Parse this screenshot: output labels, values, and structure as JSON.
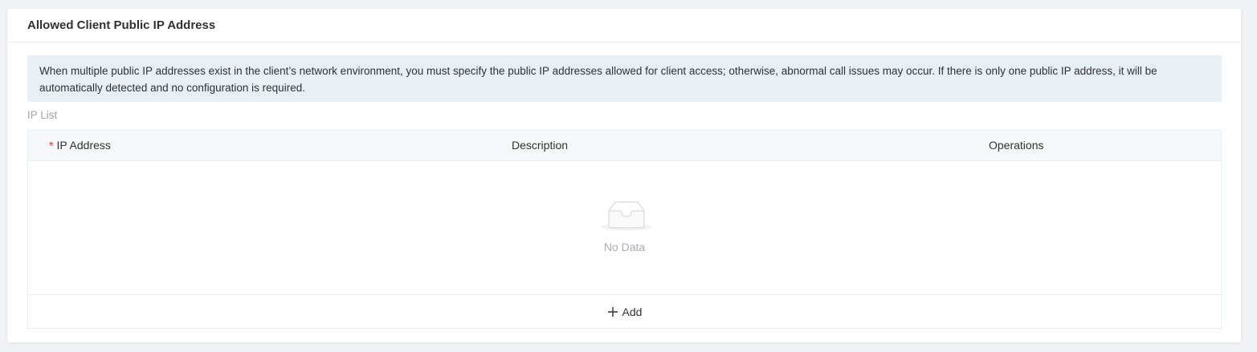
{
  "section": {
    "title": "Allowed Client Public IP Address"
  },
  "notice": {
    "text": "When multiple public IP addresses exist in the client’s network environment, you must specify the public IP addresses allowed for client access; otherwise, abnormal call issues may occur. If there is only one public IP address, it will be automatically detected and no configuration is required."
  },
  "ip_list": {
    "label": "IP List",
    "columns": {
      "required_marker": "*",
      "ip_address": "IP Address",
      "description": "Description",
      "operations": "Operations"
    },
    "rows": [],
    "empty_text": "No Data",
    "empty_icon": "empty-box-icon",
    "add_label": "Add",
    "add_icon": "plus-icon"
  },
  "colors": {
    "notice_bg": "#e8f0f6",
    "required": "#e03b3b",
    "muted_text": "#a8abb2"
  }
}
